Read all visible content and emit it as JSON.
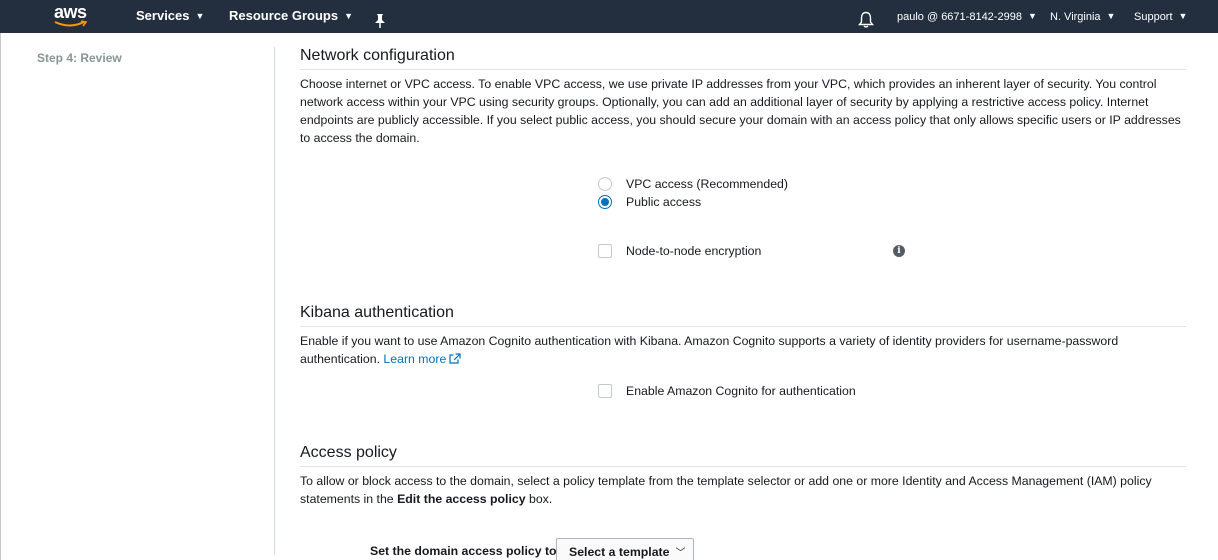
{
  "nav": {
    "logo": "aws",
    "services": "Services",
    "resource_groups": "Resource Groups",
    "account": "paulo @ 6671-8142-2998",
    "region": "N. Virginia",
    "support": "Support",
    "caret": "⌄"
  },
  "sidebar": {
    "step": "Step 4: Review"
  },
  "network": {
    "title": "Network configuration",
    "description": "Choose internet or VPC access. To enable VPC access, we use private IP addresses from your VPC, which provides an inherent layer of security. You control network access within your VPC using security groups. Optionally, you can add an additional layer of security by applying a restrictive access policy. Internet endpoints are publicly accessible. If you select public access, you should secure your domain with an access policy that only allows specific users or IP addresses to access the domain.",
    "vpc_option": "VPC access (Recommended)",
    "public_option": "Public access",
    "selected": "Public access",
    "node_encryption": "Node-to-node encryption"
  },
  "kibana": {
    "title": "Kibana authentication",
    "description": "Enable if you want to use Amazon Cognito authentication with Kibana. Amazon Cognito supports a variety of identity providers for username-password authentication.",
    "learn_more": "Learn more",
    "cognito_option": "Enable Amazon Cognito for authentication"
  },
  "access_policy": {
    "title": "Access policy",
    "description_pre": "To allow or block access to the domain, select a policy template from the template selector or add one or more Identity and Access Management (IAM) policy statements in the",
    "description_bold": "Edit the access policy",
    "description_post": "box.",
    "set_label": "Set the domain access policy to",
    "select_template": "Select a template"
  }
}
